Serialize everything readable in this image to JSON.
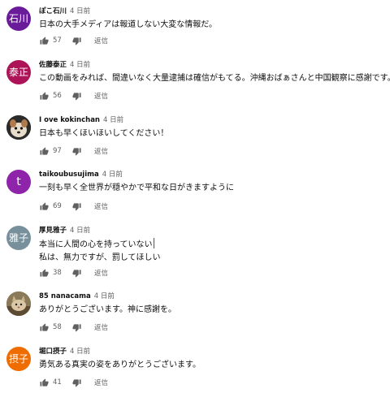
{
  "comments": [
    {
      "author": "ぽこ石川",
      "time": "4 日前",
      "avatar": {
        "type": "initials",
        "text": "石川",
        "color": "#6a1b9a"
      },
      "lines": [
        "日本の大手メディアは報道しない大変な情報だ。"
      ],
      "likes": "57",
      "reply": "返信"
    },
    {
      "author": "佐藤泰正",
      "time": "4 日前",
      "avatar": {
        "type": "initials",
        "text": "泰正",
        "color": "#ad1457"
      },
      "lines": [
        "この動画をみれば、間違いなく大量逮捕は確信がもてる。沖縄おばぁさんと中国観察に感謝です。"
      ],
      "likes": "56",
      "reply": "返信"
    },
    {
      "author": "I ove kokinchan",
      "time": "4 日前",
      "avatar": {
        "type": "photo",
        "text": ""
      },
      "lines": [
        "日本も早くほいほいしてください！"
      ],
      "likes": "97",
      "reply": "返信"
    },
    {
      "author": "taikoubusujima",
      "time": "4 日前",
      "avatar": {
        "type": "initials",
        "text": "t",
        "color": "#8e24aa"
      },
      "lines": [
        "一刻も早く全世界が穏やかで平和な日がきますように"
      ],
      "likes": "69",
      "reply": "返信"
    },
    {
      "author": "厚見雅子",
      "time": "4 日前",
      "avatar": {
        "type": "initials",
        "text": "雅子",
        "color": "#78909c"
      },
      "lines": [
        "本当に人間の心を持っていない",
        "私は、無力ですが、罰してほしい"
      ],
      "likes": "38",
      "reply": "返信"
    },
    {
      "author": "85 nanacama",
      "time": "4 日前",
      "avatar": {
        "type": "photo",
        "text": ""
      },
      "lines": [
        "ありがとうございます。神に感謝を。"
      ],
      "likes": "58",
      "reply": "返信"
    },
    {
      "author": "堀口摂子",
      "time": "4 日前",
      "avatar": {
        "type": "initials",
        "text": "摂子",
        "color": "#ef6c00"
      },
      "lines": [
        "勇気ある真実の姿をありがとうございます。"
      ],
      "likes": "41",
      "reply": "返信"
    }
  ]
}
